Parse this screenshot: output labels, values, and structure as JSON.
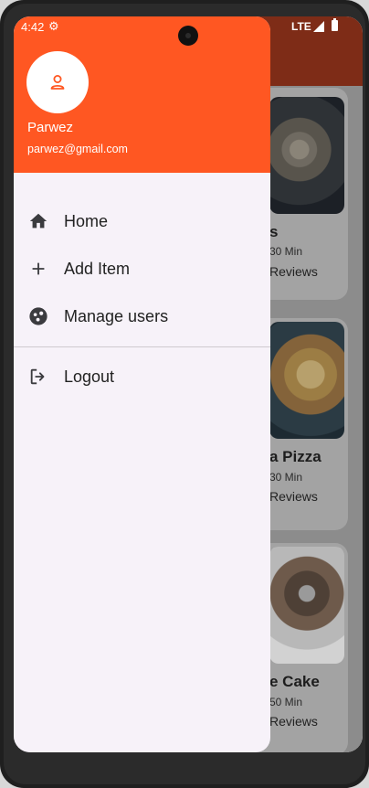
{
  "status_bar": {
    "time": "4:42",
    "network": "LTE"
  },
  "user": {
    "name": "Parwez",
    "email": "parwez@gmail.com"
  },
  "menu": {
    "items": [
      {
        "label": "Home",
        "icon": "home-icon"
      },
      {
        "label": "Add Item",
        "icon": "add-icon"
      },
      {
        "label": "Manage users",
        "icon": "manage-users-icon"
      }
    ],
    "logout_label": "Logout"
  },
  "background_list": {
    "items": [
      {
        "title_fragment": "s",
        "time": "30 Min",
        "reviews": "Reviews"
      },
      {
        "title_fragment": "a Pizza",
        "time": "30 Min",
        "reviews": "Reviews"
      },
      {
        "title_fragment": "e Cake",
        "time": "50 Min",
        "reviews": "Reviews"
      }
    ]
  },
  "colors": {
    "drawer_header": "#ff5722",
    "appbar_dim": "#7e2c17",
    "drawer_bg": "#f7f2f9"
  }
}
